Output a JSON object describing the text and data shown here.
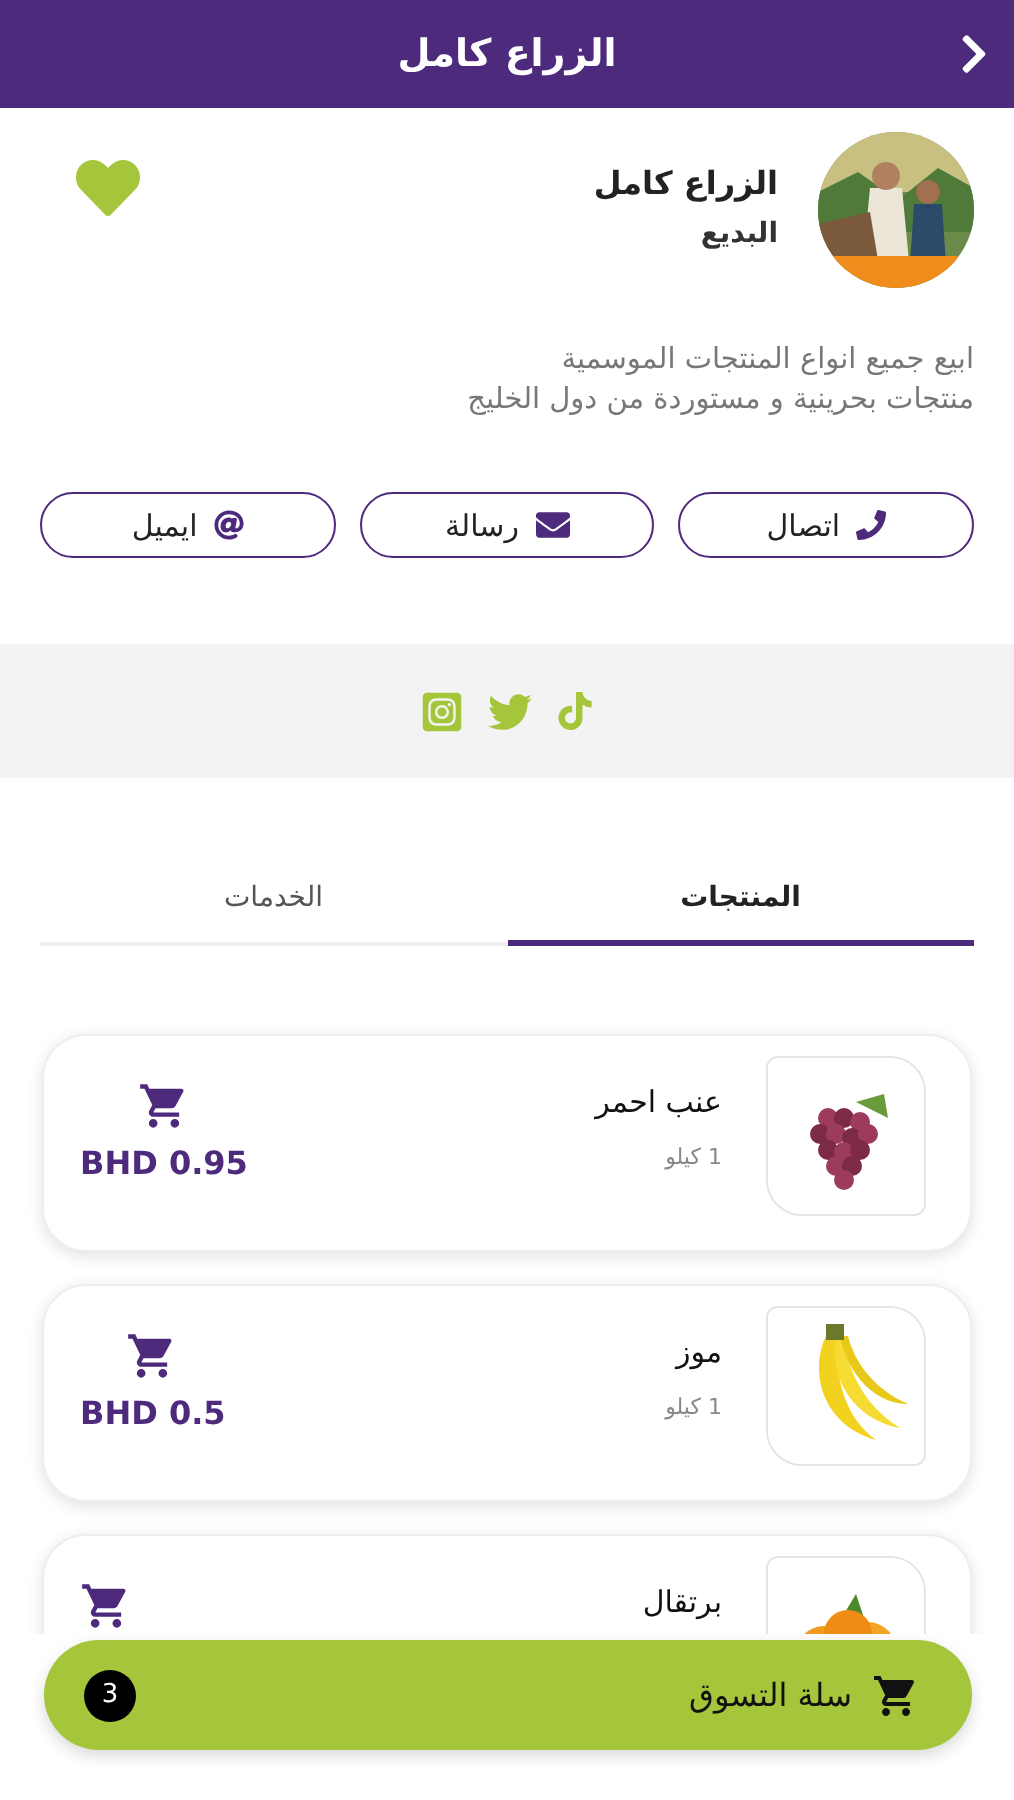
{
  "header": {
    "title": "الزراع كامل"
  },
  "profile": {
    "name": "الزراع كامل",
    "location": "البديع",
    "favorite": true,
    "description": [
      "ابيع جميع انواع المنتجات الموسمية",
      "منتجات بحرينية و مستوردة من دول الخليج"
    ]
  },
  "contact_buttons": [
    {
      "kind": "phone",
      "label": "اتصال"
    },
    {
      "kind": "message",
      "label": "رسالة"
    },
    {
      "kind": "email",
      "label": "ايميل"
    }
  ],
  "social_links": [
    {
      "kind": "instagram"
    },
    {
      "kind": "twitter"
    },
    {
      "kind": "tiktok"
    }
  ],
  "tabs": [
    {
      "label": "المنتجات",
      "selected": true
    },
    {
      "label": "الخدمات",
      "selected": false
    }
  ],
  "products": [
    {
      "kind": "grapes",
      "name": "عنب احمر",
      "unit": "1 كيلو",
      "price": "BHD 0.95"
    },
    {
      "kind": "banana",
      "name": "موز",
      "unit": "1 كيلو",
      "price": "BHD 0.5"
    },
    {
      "kind": "orange",
      "name": "برتقال"
    }
  ],
  "cart": {
    "label": "سلة التسوق",
    "count": "3"
  }
}
